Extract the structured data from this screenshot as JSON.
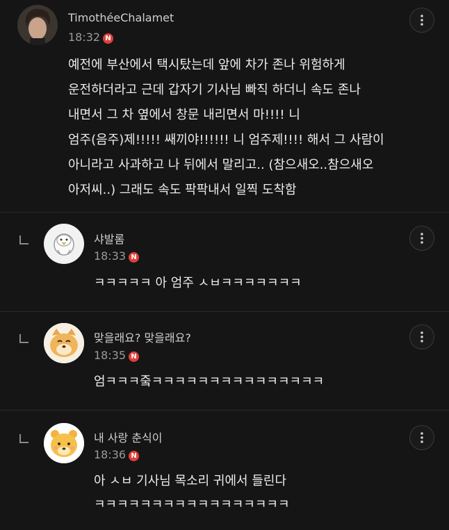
{
  "post": {
    "author": "TimothéeChalamet",
    "time": "18:32",
    "badge": "N",
    "lines": [
      "예전에 부산에서 택시탔는데 앞에 차가 존나 위험하게",
      "운전하더라고 근데 갑자기 기사님 빠직 하더니 속도 존나",
      "내면서 그 차 옆에서 창문 내리면서 마!!!! 니",
      "엄주(음주)제!!!!! 쌔끼야!!!!!! 니 엄주제!!!! 해서 그 사람이",
      "아니라고 사과하고 나 뒤에서 말리고.. (참으새오..참으새오",
      "아저씨..) 그래도 속도 팍팍내서 일찍 도착함"
    ]
  },
  "replies": [
    {
      "author": "샤발롬",
      "time": "18:33",
      "badge": "N",
      "lines": [
        "ㅋㅋㅋㅋㅋ 아 엄주 ㅅㅂㅋㅋㅋㅋㅋㅋㅋ"
      ]
    },
    {
      "author": "맞을래요? 맞을래요?",
      "time": "18:35",
      "badge": "N",
      "lines": [
        "엄ㅋㅋㅋ줔ㅋㅋㅋㅋㅋㅋㅋㅋㅋㅋㅋㅋㅋㅋㅋ"
      ]
    },
    {
      "author": "내 사랑 춘식이",
      "time": "18:36",
      "badge": "N",
      "lines": [
        "아 ㅅㅂ 기사님 목소리 귀에서 들린다",
        "ㅋㅋㅋㅋㅋㅋㅋㅋㅋㅋㅋㅋㅋㅋㅋㅋㅋ"
      ]
    }
  ],
  "icons": {
    "more": "more-vertical-icon",
    "reply": "reply-arrow-icon"
  },
  "colors": {
    "background": "#151515",
    "badge": "#e0403a",
    "text": "#ececec"
  }
}
